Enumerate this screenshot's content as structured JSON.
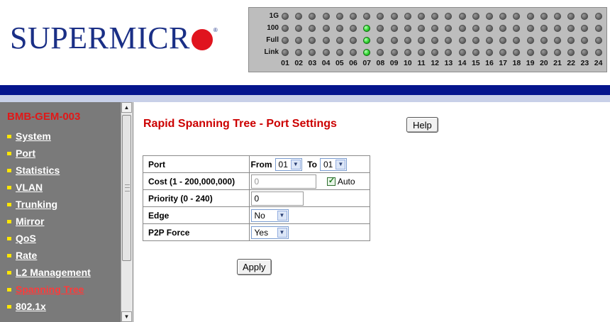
{
  "brand": {
    "logo_text": "SUPERMICR",
    "registered_mark": "®"
  },
  "port_panel": {
    "rows": [
      {
        "label": "1G",
        "lit_ports": []
      },
      {
        "label": "100",
        "lit_ports": [
          "07"
        ]
      },
      {
        "label": "Full",
        "lit_ports": [
          "07"
        ]
      },
      {
        "label": "Link",
        "lit_ports": [
          "07"
        ]
      }
    ],
    "ports": [
      "01",
      "02",
      "03",
      "04",
      "05",
      "06",
      "07",
      "08",
      "09",
      "10",
      "11",
      "12",
      "13",
      "14",
      "15",
      "16",
      "17",
      "18",
      "19",
      "20",
      "21",
      "22",
      "23",
      "24"
    ],
    "colors": {
      "led_on": "#36d936",
      "led_off": "#6a6a6a"
    }
  },
  "sidebar": {
    "device_name": "BMB-GEM-003",
    "items": [
      {
        "label": "System",
        "active": false
      },
      {
        "label": "Port",
        "active": false
      },
      {
        "label": "Statistics",
        "active": false
      },
      {
        "label": "VLAN",
        "active": false
      },
      {
        "label": "Trunking",
        "active": false
      },
      {
        "label": "Mirror",
        "active": false
      },
      {
        "label": "QoS",
        "active": false
      },
      {
        "label": "Rate",
        "active": false
      },
      {
        "label": "L2 Management",
        "active": false
      },
      {
        "label": "Spanning Tree",
        "active": true
      },
      {
        "label": "802.1x",
        "active": false
      }
    ]
  },
  "main": {
    "title": "Rapid Spanning Tree - Port Settings",
    "help_label": "Help",
    "form": {
      "port": {
        "label": "Port",
        "from_label": "From",
        "from_value": "01",
        "to_label": "To",
        "to_value": "01"
      },
      "cost": {
        "label": "Cost (1 - 200,000,000)",
        "value": "0",
        "auto_label": "Auto",
        "auto_checked": true
      },
      "priority": {
        "label": "Priority (0 - 240)",
        "value": "0"
      },
      "edge": {
        "label": "Edge",
        "value": "No"
      },
      "p2p_force": {
        "label": "P2P Force",
        "value": "Yes"
      }
    },
    "apply_label": "Apply"
  },
  "colors": {
    "brand": "#1a2f86",
    "logo_dot": "#e0141e",
    "header_bar": "#05158d",
    "sidebar_bg": "#7a7a7a",
    "title": "#cc0000",
    "active_nav": "#ff3a3a",
    "bullet": "#ffe600"
  }
}
